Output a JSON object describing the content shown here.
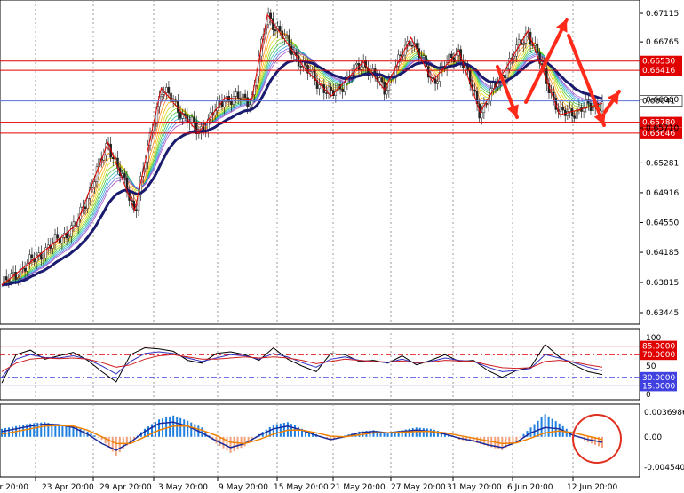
{
  "chart_data": [
    {
      "type": "candlestick",
      "panel": "price",
      "y_ticks": [
        "0.67115",
        "0.66765",
        "0.66060",
        "0.65710",
        "0.65281",
        "0.64916",
        "0.64550",
        "0.64185",
        "0.63815",
        "0.63445"
      ],
      "price_levels": [
        {
          "value": "0.66530",
          "color": "#e00000"
        },
        {
          "value": "0.66416",
          "color": "#e00000"
        },
        {
          "value": "0.65780",
          "color": "#e00000"
        },
        {
          "value": "0.65646",
          "color": "#e00000"
        }
      ],
      "current_price": {
        "value": "0.66041",
        "color": "#5a6fd6"
      },
      "x_ticks": [
        "or 20:00",
        "23 Apr 20:00",
        "29 Apr 20:00",
        "3 May 20:00",
        "9 May 20:00",
        "15 May 20:00",
        "21 May 20:00",
        "27 May 20:00",
        "31 May 20:00",
        "6 Jun 20:00",
        "12 Jun 20:00"
      ],
      "zigzag": [
        [
          0,
          0.6378
        ],
        [
          1.4,
          0.6452
        ],
        [
          2,
          0.6553
        ],
        [
          2.5,
          0.647
        ],
        [
          3,
          0.662
        ],
        [
          3.7,
          0.6565
        ],
        [
          4.2,
          0.6608
        ],
        [
          4.7,
          0.6605
        ],
        [
          5,
          0.671
        ],
        [
          5.7,
          0.6644
        ],
        [
          6.2,
          0.661
        ],
        [
          6.8,
          0.6652
        ],
        [
          7.2,
          0.6618
        ],
        [
          7.7,
          0.6682
        ],
        [
          8.1,
          0.6628
        ],
        [
          8.6,
          0.6666
        ],
        [
          9.0,
          0.659
        ],
        [
          9.9,
          0.669
        ],
        [
          10.5,
          0.6587
        ],
        [
          11.3,
          0.6601
        ]
      ],
      "highlight_arrows": [
        "down",
        "up",
        "down",
        "up"
      ],
      "colors": {
        "ma_slow": "#1a1a6e",
        "zigzag": "#e00000",
        "arrows": "#ff2a1a",
        "grid": "#9a9a9a"
      }
    },
    {
      "type": "line",
      "panel": "oscillator",
      "y_ticks": [
        "100",
        "50",
        "0"
      ],
      "levels": [
        {
          "value": "85.0000",
          "color": "#e00000"
        },
        {
          "value": "70.0000",
          "color": "#e00000"
        },
        {
          "value": "30.0000",
          "color": "#4040e0"
        },
        {
          "value": "15.0000",
          "color": "#4040e0"
        }
      ],
      "series": [
        {
          "color": "#000000",
          "values": [
            20,
            70,
            78,
            62,
            68,
            74,
            60,
            40,
            22,
            70,
            82,
            80,
            76,
            60,
            55,
            72,
            75,
            70,
            60,
            82,
            62,
            50,
            40,
            72,
            70,
            58,
            60,
            55,
            68,
            52,
            60,
            70,
            58,
            60,
            42,
            30,
            42,
            48,
            88,
            66,
            52,
            40,
            35
          ]
        },
        {
          "color": "#3030c0",
          "values": [
            30,
            62,
            70,
            65,
            64,
            68,
            62,
            50,
            36,
            58,
            72,
            75,
            72,
            64,
            58,
            64,
            70,
            68,
            62,
            72,
            66,
            56,
            48,
            62,
            66,
            60,
            58,
            56,
            62,
            55,
            58,
            64,
            60,
            58,
            48,
            40,
            42,
            46,
            70,
            64,
            56,
            48,
            42
          ]
        },
        {
          "color": "#d02020",
          "values": [
            40,
            55,
            62,
            64,
            63,
            64,
            62,
            56,
            48,
            52,
            62,
            68,
            70,
            66,
            62,
            62,
            64,
            66,
            64,
            66,
            64,
            60,
            54,
            58,
            62,
            60,
            58,
            57,
            59,
            56,
            57,
            60,
            59,
            58,
            52,
            47,
            46,
            47,
            58,
            60,
            57,
            52,
            48
          ]
        }
      ]
    },
    {
      "type": "bar",
      "panel": "macd",
      "y_ticks": [
        "0.0036986",
        "0.00",
        "-0.0045405"
      ],
      "ylim": [
        -0.0045405,
        0.0036986
      ],
      "histogram": [
        0.0012,
        0.0016,
        0.002,
        0.0022,
        0.0018,
        0.0016,
        0.0008,
        -0.0004,
        -0.0028,
        -0.0008,
        0.0012,
        0.0026,
        0.0032,
        0.0024,
        0.0014,
        -0.001,
        -0.0024,
        -0.0014,
        0.0004,
        0.0018,
        0.0022,
        0.0012,
        0.0004,
        -0.0006,
        0.0002,
        0.0008,
        0.001,
        0.0006,
        0.001,
        0.0014,
        0.0012,
        0.0006,
        -0.0004,
        -0.0008,
        -0.0014,
        -0.002,
        -0.0006,
        0.0014,
        0.0034,
        0.002,
        0.0004,
        -0.0008,
        -0.0016
      ],
      "macd_line": [
        0.0008,
        0.0012,
        0.0016,
        0.0019,
        0.0018,
        0.0014,
        0.0004,
        -0.001,
        -0.002,
        -0.0008,
        0.0008,
        0.002,
        0.0022,
        0.0016,
        0.0006,
        -0.0006,
        -0.0016,
        -0.001,
        0.0002,
        0.0012,
        0.0016,
        0.001,
        0.0002,
        -0.0004,
        0.0,
        0.0006,
        0.0008,
        0.0006,
        0.0008,
        0.001,
        0.0008,
        0.0004,
        -0.0002,
        -0.0006,
        -0.0012,
        -0.0016,
        -0.0008,
        0.0006,
        0.0014,
        0.0012,
        0.0002,
        -0.0004,
        -0.0008
      ],
      "signal_line": [
        0.0004,
        0.0008,
        0.0012,
        0.0016,
        0.0017,
        0.0016,
        0.001,
        0.0,
        -0.001,
        -0.001,
        0.0,
        0.001,
        0.0016,
        0.0016,
        0.001,
        0.0002,
        -0.0008,
        -0.001,
        -0.0004,
        0.0004,
        0.001,
        0.001,
        0.0006,
        0.0001,
        0.0,
        0.0003,
        0.0006,
        0.0006,
        0.0007,
        0.0008,
        0.0008,
        0.0006,
        0.0002,
        -0.0002,
        -0.0006,
        -0.001,
        -0.0009,
        -0.0002,
        0.0006,
        0.0009,
        0.0006,
        0.0001,
        -0.0004
      ],
      "colors": {
        "positive": "#2080e0",
        "negative": "#f0a07a",
        "macd_line": "#1a2a9a",
        "signal_line": "#f08000",
        "highlight_circle": "#e03020"
      }
    }
  ]
}
